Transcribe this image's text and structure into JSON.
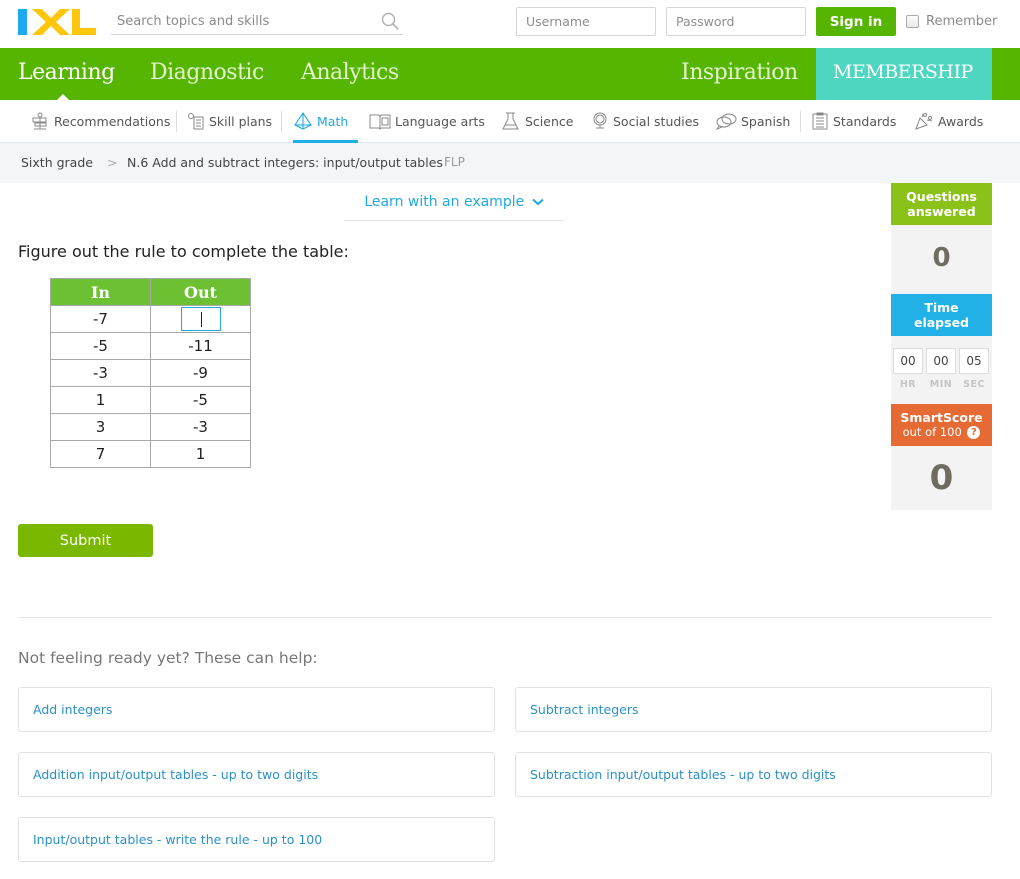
{
  "header": {
    "logo_text": "IXL",
    "search": {
      "placeholder": "Search topics and skills",
      "value": ""
    },
    "username": {
      "placeholder": "Username",
      "value": ""
    },
    "password": {
      "placeholder": "Password",
      "value": ""
    },
    "signin_label": "Sign in",
    "remember_label": "Remember",
    "remember_checked": false
  },
  "main_nav": {
    "items": [
      {
        "label": "Learning",
        "active": true
      },
      {
        "label": "Diagnostic",
        "active": false
      },
      {
        "label": "Analytics",
        "active": false
      }
    ],
    "right_items": [
      {
        "label": "Inspiration"
      },
      {
        "label": "MEMBERSHIP"
      }
    ]
  },
  "subject_nav": {
    "items": [
      {
        "label": "Recommendations",
        "icon": "signpost-icon"
      },
      {
        "label": "Skill plans",
        "icon": "skill-plans-icon"
      },
      {
        "label": "Math",
        "icon": "pyramid-icon",
        "active": true
      },
      {
        "label": "Language arts",
        "icon": "book-icon"
      },
      {
        "label": "Science",
        "icon": "flask-icon"
      },
      {
        "label": "Social studies",
        "icon": "globe-icon"
      },
      {
        "label": "Spanish",
        "icon": "speech-bubbles-icon"
      },
      {
        "label": "Standards",
        "icon": "clipboard-icon"
      },
      {
        "label": "Awards",
        "icon": "party-popper-icon"
      }
    ]
  },
  "breadcrumb": {
    "grade": "Sixth grade",
    "separator": ">",
    "skill": "N.6 Add and subtract integers: input/output tables",
    "code": "FLP"
  },
  "question": {
    "learn_link": "Learn with an example",
    "prompt": "Figure out the rule to complete the table:",
    "table": {
      "headers": [
        "In",
        "Out"
      ],
      "rows": [
        {
          "in": "-7",
          "out": ""
        },
        {
          "in": "-5",
          "out": "-11"
        },
        {
          "in": "-3",
          "out": "-9"
        },
        {
          "in": "1",
          "out": "-5"
        },
        {
          "in": "3",
          "out": "-3"
        },
        {
          "in": "7",
          "out": "1"
        }
      ]
    },
    "answer_value": "",
    "submit_label": "Submit"
  },
  "stats": {
    "questions_answered": {
      "label_line1": "Questions",
      "label_line2": "answered",
      "value": "0"
    },
    "time_elapsed": {
      "label_line1": "Time",
      "label_line2": "elapsed",
      "hr": "00",
      "min": "00",
      "sec": "05",
      "hr_label": "HR",
      "min_label": "MIN",
      "sec_label": "SEC"
    },
    "smartscore": {
      "label": "SmartScore",
      "sublabel": "out of 100",
      "help": "?",
      "value": "0"
    }
  },
  "help": {
    "heading": "Not feeling ready yet? These can help:",
    "links": [
      "Add integers",
      "Subtract integers",
      "Addition input/output tables - up to two digits",
      "Subtraction input/output tables - up to two digits",
      "Input/output tables - write the rule - up to 100"
    ]
  },
  "colors": {
    "brand_green": "#56b500",
    "membership_teal": "#4fd6c0",
    "accent_blue": "#20a8e0",
    "table_header_green": "#6cc031",
    "submit_green": "#7ab800",
    "questions_green": "#8bc21a",
    "time_blue": "#21b1e6",
    "smartscore_orange": "#e56a34"
  }
}
